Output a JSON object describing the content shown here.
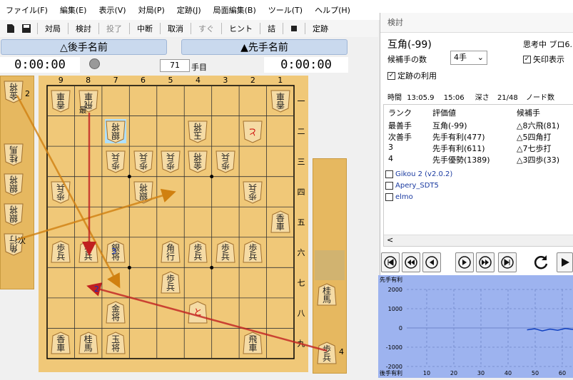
{
  "menu": [
    "ファイル(F)",
    "編集(E)",
    "表示(V)",
    "対局(P)",
    "定跡(J)",
    "局面編集(B)",
    "ツール(T)",
    "ヘルプ(H)"
  ],
  "toolbar": {
    "b1": "対局",
    "b2": "検討",
    "b3": "投了",
    "b4": "中断",
    "b5": "取消",
    "b6": "すぐ",
    "b7": "ヒント",
    "b8": "詰",
    "b9": "定跡"
  },
  "players": {
    "gote": "△後手名前",
    "sente": "▲先手名前"
  },
  "clocks": {
    "gote": "0:00:00",
    "sente": "0:00:00"
  },
  "move": {
    "number": "71",
    "suffix": "手目"
  },
  "board": {
    "files": [
      "9",
      "8",
      "7",
      "6",
      "5",
      "4",
      "3",
      "2",
      "1"
    ],
    "ranks": [
      "一",
      "二",
      "三",
      "四",
      "五",
      "六",
      "七",
      "八",
      "九"
    ],
    "pieces": [
      {
        "file": 9,
        "rank": 1,
        "ch": "香車",
        "gote": true
      },
      {
        "file": 8,
        "rank": 1,
        "ch": "飛車",
        "gote": true,
        "promo": false,
        "mark": "最"
      },
      {
        "file": 1,
        "rank": 1,
        "ch": "香車",
        "gote": true
      },
      {
        "file": 7,
        "rank": 2,
        "ch": "銀将",
        "gote": true,
        "highlight": true
      },
      {
        "file": 4,
        "rank": 2,
        "ch": "玉将",
        "gote": true
      },
      {
        "file": 2,
        "rank": 2,
        "ch": "と",
        "gote": true,
        "promo": true
      },
      {
        "file": 7,
        "rank": 3,
        "ch": "歩兵",
        "gote": true
      },
      {
        "file": 6,
        "rank": 3,
        "ch": "歩兵",
        "gote": true
      },
      {
        "file": 5,
        "rank": 3,
        "ch": "歩兵",
        "gote": true
      },
      {
        "file": 4,
        "rank": 3,
        "ch": "金将",
        "gote": true
      },
      {
        "file": 3,
        "rank": 3,
        "ch": "歩兵",
        "gote": true
      },
      {
        "file": 9,
        "rank": 4,
        "ch": "歩兵",
        "gote": true
      },
      {
        "file": 6,
        "rank": 4,
        "ch": "銀将",
        "gote": true
      },
      {
        "file": 2,
        "rank": 4,
        "ch": "歩兵",
        "gote": true
      },
      {
        "file": 1,
        "rank": 5,
        "ch": "香車",
        "gote": false
      },
      {
        "file": 9,
        "rank": 6,
        "ch": "歩兵",
        "gote": false
      },
      {
        "file": 8,
        "rank": 6,
        "ch": "歩兵",
        "gote": false
      },
      {
        "file": 7,
        "rank": 6,
        "ch": "銀将",
        "gote": false
      },
      {
        "file": 5,
        "rank": 6,
        "ch": "角行",
        "gote": false
      },
      {
        "file": 4,
        "rank": 6,
        "ch": "歩兵",
        "gote": false
      },
      {
        "file": 3,
        "rank": 6,
        "ch": "歩兵",
        "gote": false
      },
      {
        "file": 2,
        "rank": 6,
        "ch": "歩兵",
        "gote": false
      },
      {
        "file": 5,
        "rank": 7,
        "ch": "歩兵",
        "gote": false
      },
      {
        "file": 7,
        "rank": 8,
        "ch": "金将",
        "gote": false
      },
      {
        "file": 4,
        "rank": 8,
        "ch": "と",
        "gote": false,
        "promo": true
      },
      {
        "file": 9,
        "rank": 9,
        "ch": "香車",
        "gote": false
      },
      {
        "file": 8,
        "rank": 9,
        "ch": "桂馬",
        "gote": false
      },
      {
        "file": 7,
        "rank": 9,
        "ch": "玉将",
        "gote": false
      },
      {
        "file": 2,
        "rank": 9,
        "ch": "飛車",
        "gote": false
      }
    ],
    "goteHand": [
      "金将",
      "桂馬",
      "銀将",
      "銀将",
      "角行"
    ],
    "goteHandCounts": [
      "2",
      "",
      "",
      "",
      ""
    ],
    "goteHandMark": "次",
    "senteHand": [
      "桂馬",
      "歩兵"
    ],
    "senteHandCounts": [
      "",
      "4"
    ],
    "arrowLabels": [
      "2",
      "3"
    ]
  },
  "analysis": {
    "title": "検討",
    "position_eval": "互角(-99)",
    "thinking": "思考中 ブロ6.",
    "candidates_label": "候補手の数",
    "candidates_value": "4手",
    "arrows_label": "矢印表示",
    "joseki_label": "定跡の利用",
    "stats": {
      "time_label": "時間",
      "time1": "13:05.9",
      "time2": "15:06",
      "depth_label": "深さ",
      "depth": "21/48",
      "nodes_label": "ノード数"
    },
    "headers": [
      "ランク",
      "評価値",
      "候補手"
    ],
    "rows": [
      [
        "最善手",
        "互角(-99)",
        "△8六飛(81)"
      ],
      [
        "次善手",
        "先手有利(477)",
        "△5四角打"
      ],
      [
        "3",
        "先手有利(611)",
        "△7七歩打"
      ],
      [
        "4",
        "先手優勢(1389)",
        "△3四歩(33)"
      ]
    ],
    "engines": [
      "Gikou 2 (v2.0.2)",
      "Apery_SDT5",
      "elmo"
    ]
  },
  "graph": {
    "top_label": "先手有利",
    "bottom_label": "後手有利",
    "y_ticks": [
      "2000",
      "1000",
      "0",
      "-1000",
      "-2000"
    ],
    "x_ticks": [
      "10",
      "20",
      "30",
      "40",
      "50",
      "60"
    ],
    "line_color": "#1040c0",
    "evals": [
      -99,
      -40,
      -150,
      -60,
      -120,
      -30,
      -80
    ]
  },
  "colors": {
    "board": "#f0c878",
    "komadai": "#e6b860",
    "arrow": "#d08010",
    "arrow_best": "#c02020"
  }
}
